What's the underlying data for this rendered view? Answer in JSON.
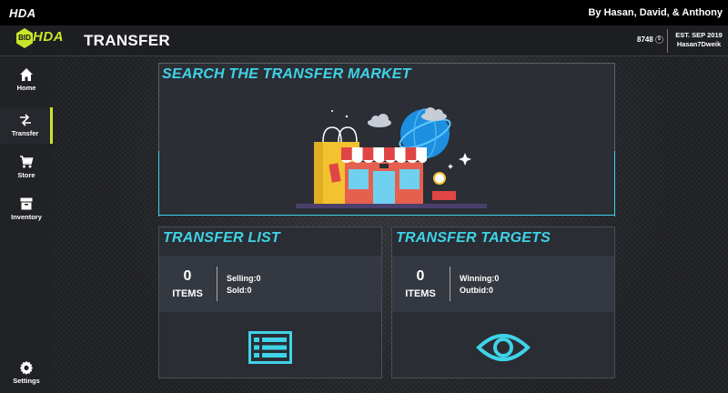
{
  "titlebar": {
    "app_title": "HDA",
    "authors": "By Hasan, David, & Anthony"
  },
  "header": {
    "logo_badge": "BID",
    "logo_text": "HDA",
    "page_title": "TRANSFER",
    "coins": "8748",
    "coin_symbol": "$",
    "est": "EST. SEP 2019",
    "username": "Hasan7Dweik"
  },
  "sidebar": {
    "items": [
      {
        "label": "Home",
        "icon": "home-icon"
      },
      {
        "label": "Transfer",
        "icon": "transfer-icon"
      },
      {
        "label": "Store",
        "icon": "cart-icon"
      },
      {
        "label": "Inventory",
        "icon": "inventory-icon"
      }
    ],
    "settings": {
      "label": "Settings",
      "icon": "gear-icon"
    }
  },
  "market": {
    "title": "SEARCH THE TRANSFER MARKET"
  },
  "transfer_list": {
    "title": "TRANSFER LIST",
    "count": "0",
    "count_label": "ITEMS",
    "line1": "Selling:0",
    "line2": "Sold:0"
  },
  "transfer_targets": {
    "title": "TRANSFER TARGETS",
    "count": "0",
    "count_label": "ITEMS",
    "line1": "Winning:0",
    "line2": "Outbid:0"
  },
  "colors": {
    "accent": "#3fd3e8",
    "logo": "#c8e62a",
    "background": "#2b2d33"
  }
}
